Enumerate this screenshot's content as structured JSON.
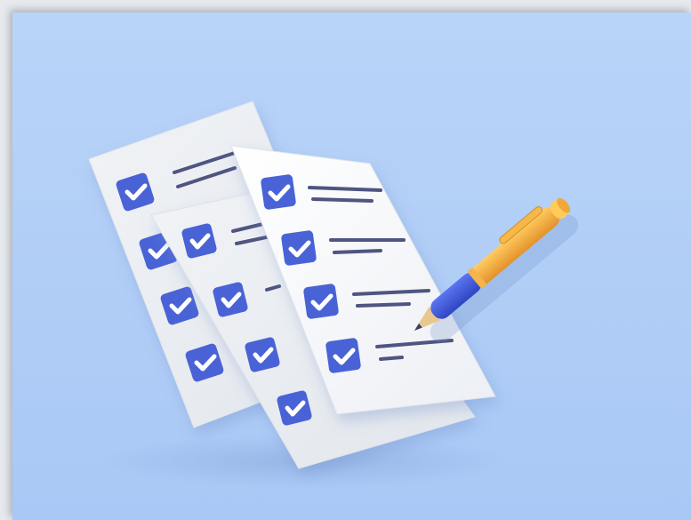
{
  "scene": {
    "subject": "checklist-illustration",
    "colors": {
      "background_top": "#b9d4f8",
      "background_bottom": "#a9c9f6",
      "paper": "#f7f8fa",
      "paper_shade": "#e9ecf1",
      "checkbox": "#4a63d6",
      "checkmark": "#ffffff",
      "text_line": "#4f5480",
      "pen_barrel": "#f2a93b",
      "pen_grip": "#3f5be0",
      "pen_tip": "#e8c88f"
    },
    "icons": [
      "checkbox-checked-icon",
      "pen-icon",
      "document-icon"
    ]
  }
}
